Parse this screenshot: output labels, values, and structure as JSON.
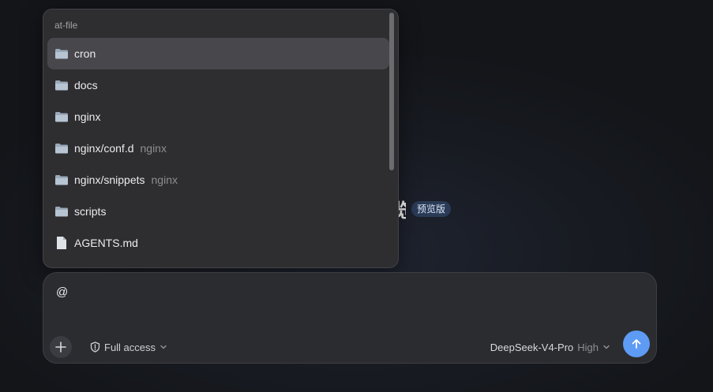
{
  "popup": {
    "header": "at-file",
    "items": [
      {
        "label": "cron",
        "parent": "",
        "icon": "folder-icon",
        "selected": true
      },
      {
        "label": "docs",
        "parent": "",
        "icon": "folder-icon",
        "selected": false
      },
      {
        "label": "nginx",
        "parent": "",
        "icon": "folder-icon",
        "selected": false
      },
      {
        "label": "nginx/conf.d",
        "parent": "nginx",
        "icon": "folder-icon",
        "selected": false
      },
      {
        "label": "nginx/snippets",
        "parent": "nginx",
        "icon": "folder-icon",
        "selected": false
      },
      {
        "label": "scripts",
        "parent": "",
        "icon": "folder-icon",
        "selected": false
      },
      {
        "label": "AGENTS.md",
        "parent": "",
        "icon": "file-icon",
        "selected": false
      }
    ]
  },
  "background": {
    "title_tail": "览",
    "badge": "预览版"
  },
  "composer": {
    "input_value": "@",
    "add_icon": "plus-icon",
    "access_icon": "shield-icon",
    "access_label": "Full access",
    "model_name": "DeepSeek-V4-Pro",
    "model_effort": "High",
    "send_icon": "arrow-up-icon",
    "send_color": "#5d9bf5"
  }
}
